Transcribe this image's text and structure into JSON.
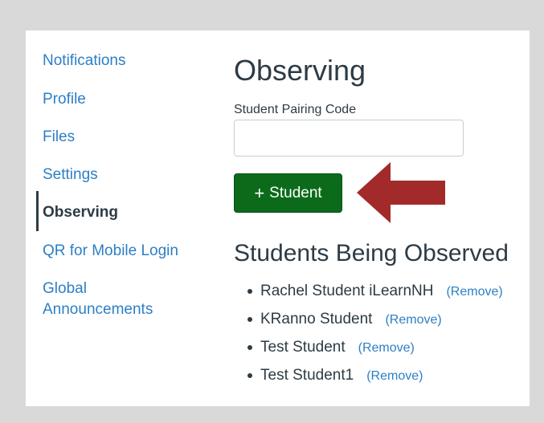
{
  "sidebar": {
    "items": [
      {
        "label": "Notifications",
        "active": false
      },
      {
        "label": "Profile",
        "active": false
      },
      {
        "label": "Files",
        "active": false
      },
      {
        "label": "Settings",
        "active": false
      },
      {
        "label": "Observing",
        "active": true
      },
      {
        "label": "QR for Mobile Login",
        "active": false
      },
      {
        "label": "Global",
        "label2": "Announcements",
        "active": false
      }
    ]
  },
  "main": {
    "title": "Observing",
    "pairing_label": "Student Pairing Code",
    "pairing_value": "",
    "add_button": {
      "icon": "plus-icon",
      "symbol": "+",
      "label": "Student"
    },
    "observed_heading": "Students Being Observed",
    "students": [
      {
        "name": "Rachel Student iLearnNH",
        "remove": "(Remove)"
      },
      {
        "name": "KRanno Student",
        "remove": "(Remove)"
      },
      {
        "name": "Test Student",
        "remove": "(Remove)"
      },
      {
        "name": "Test Student1",
        "remove": "(Remove)"
      }
    ]
  },
  "colors": {
    "link": "#2d7fc6",
    "text": "#2d3b45",
    "button": "#0b6b1a",
    "arrow": "#a32a2a",
    "background": "#d9d9d9"
  }
}
